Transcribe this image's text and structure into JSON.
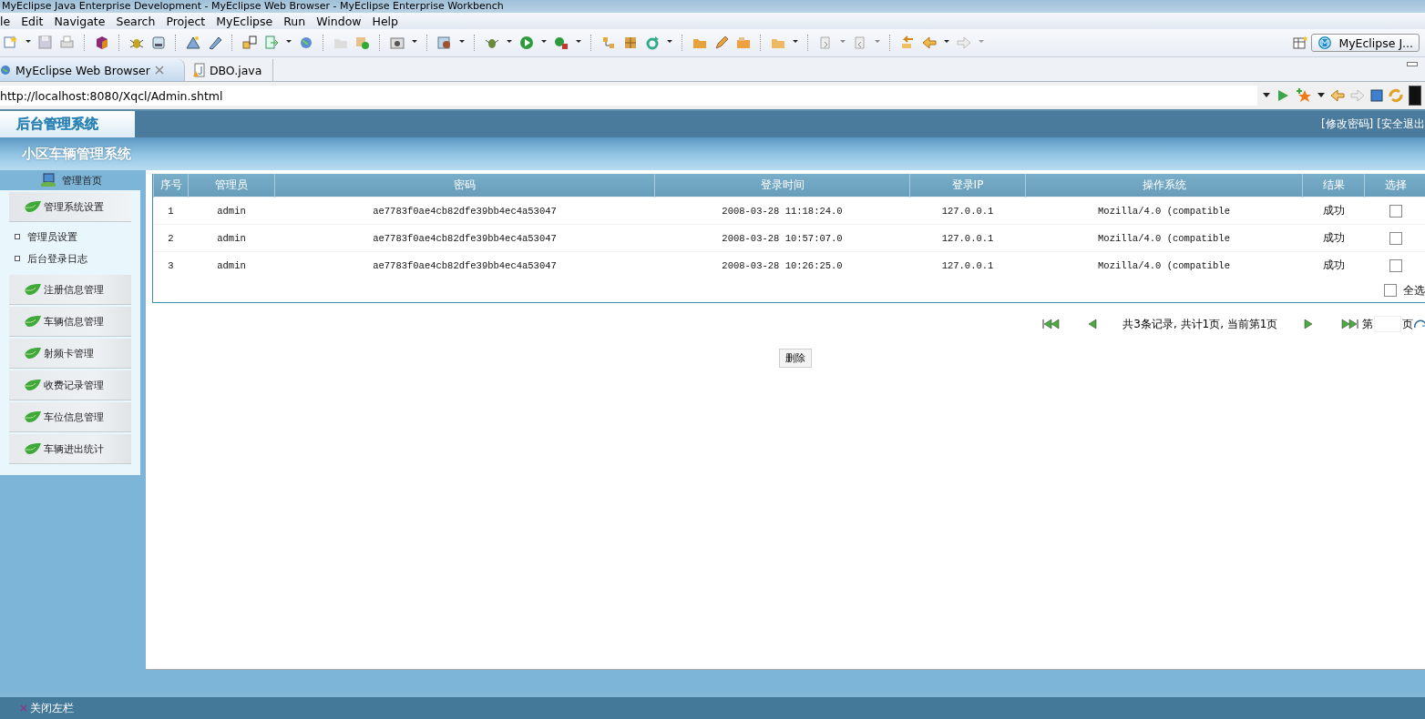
{
  "window": {
    "title": "MyEclipse Java Enterprise Development - MyEclipse Web Browser - MyEclipse Enterprise Workbench"
  },
  "menu": [
    "le",
    "Edit",
    "Navigate",
    "Search",
    "Project",
    "MyEclipse",
    "Run",
    "Window",
    "Help"
  ],
  "perspective_button": "MyEclipse J...",
  "editor_tabs": [
    {
      "label": "MyEclipse Web Browser",
      "selected": true
    },
    {
      "label": "DBO.java",
      "selected": false
    }
  ],
  "address_bar": {
    "value": "http://localhost:8080/Xqcl/Admin.shtml"
  },
  "site": {
    "logo": "后台管理系统",
    "header_links": [
      "[修改密码]",
      "[安全退出"
    ],
    "subtitle": "小区车辆管理系统"
  },
  "sidebar": {
    "home": "管理首页",
    "groups": [
      {
        "label": "管理系统设置",
        "expanded": true,
        "children": [
          {
            "label": "管理员设置"
          },
          {
            "label": "后台登录日志"
          }
        ]
      },
      {
        "label": "注册信息管理",
        "expanded": false
      },
      {
        "label": "车辆信息管理",
        "expanded": false
      },
      {
        "label": "射频卡管理",
        "expanded": false
      },
      {
        "label": "收费记录管理",
        "expanded": false
      },
      {
        "label": "车位信息管理",
        "expanded": false
      },
      {
        "label": "车辆进出统计",
        "expanded": false
      }
    ]
  },
  "table": {
    "columns": [
      "序号",
      "管理员",
      "密码",
      "登录时间",
      "登录IP",
      "操作系统",
      "结果",
      "选择"
    ],
    "rows": [
      {
        "cells": [
          "1",
          "admin",
          "ae7783f0ae4cb82dfe39bb4ec4a53047",
          "2008-03-28 11:18:24.0",
          "127.0.0.1",
          "Mozilla/4.0 (compatible",
          "成功"
        ],
        "checked": false
      },
      {
        "cells": [
          "2",
          "admin",
          "ae7783f0ae4cb82dfe39bb4ec4a53047",
          "2008-03-28 10:57:07.0",
          "127.0.0.1",
          "Mozilla/4.0 (compatible",
          "成功"
        ],
        "checked": false
      },
      {
        "cells": [
          "3",
          "admin",
          "ae7783f0ae4cb82dfe39bb4ec4a53047",
          "2008-03-28 10:26:25.0",
          "127.0.0.1",
          "Mozilla/4.0 (compatible",
          "成功"
        ],
        "checked": false
      }
    ],
    "select_all": {
      "label": "全选",
      "checked": false
    }
  },
  "pagination": {
    "summary": "共3条记录, 共计1页, 当前第1页",
    "page_prefix": "第",
    "page_suffix": "页"
  },
  "delete_button": "删除",
  "footer": {
    "close_sidebar": "关闭左栏"
  }
}
